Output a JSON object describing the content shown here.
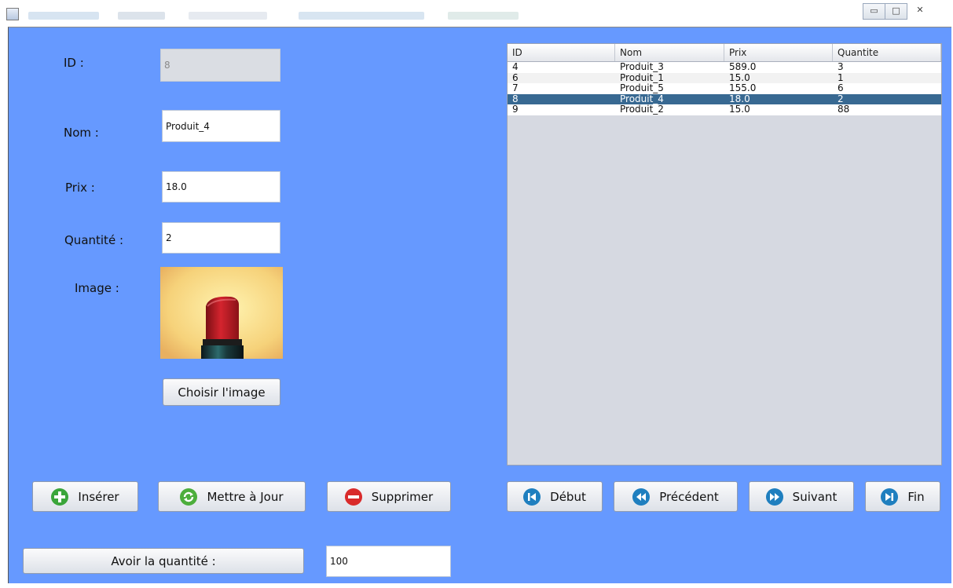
{
  "form": {
    "id_label": "ID :",
    "id_value": "8",
    "nom_label": "Nom :",
    "nom_value": "Produit_4",
    "prix_label": "Prix :",
    "prix_value": "18.0",
    "quantite_label": "Quantité :",
    "quantite_value": "2",
    "image_label": "Image :",
    "choose_image_label": "Choisir l'image"
  },
  "actions": {
    "insert_label": "Insérer",
    "update_label": "Mettre à Jour",
    "delete_label": "Supprimer"
  },
  "navigation": {
    "first_label": "Début",
    "previous_label": "Précédent",
    "next_label": "Suivant",
    "last_label": "Fin"
  },
  "quantity_query": {
    "button_label": "Avoir la quantité :",
    "value": "100"
  },
  "table": {
    "columns": [
      "ID",
      "Nom",
      "Prix",
      "Quantite"
    ],
    "rows": [
      [
        "4",
        "Produit_3",
        "589.0",
        "3"
      ],
      [
        "6",
        "Produit_1",
        "15.0",
        "1"
      ],
      [
        "7",
        "Produit_5",
        "155.0",
        "6"
      ],
      [
        "8",
        "Produit_4",
        "18.0",
        "2"
      ],
      [
        "9",
        "Produit_2",
        "15.0",
        "88"
      ]
    ],
    "selected_row": 3
  },
  "window_controls": {
    "minimize": "▭",
    "maximize": "□",
    "close": "✕"
  },
  "colors": {
    "panel_background": "#6699ff",
    "selection": "#386992",
    "insert_icon": "#3aa53a",
    "update_icon": "#4cae3c",
    "delete_icon": "#d92b2b",
    "nav_icon": "#1f7fbf"
  }
}
